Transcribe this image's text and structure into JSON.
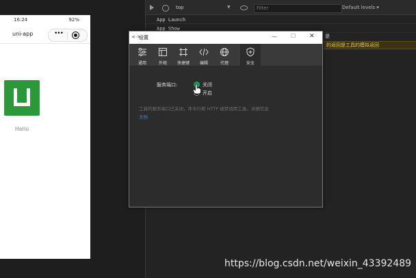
{
  "phone": {
    "time": "16:24",
    "battery": "92%",
    "nav_title": "uni-app",
    "capsule_dots": "•••",
    "hello": "Hello"
  },
  "devtools": {
    "top_select": "top",
    "filter_placeholder": "Filter",
    "levels": "Default levels ▾",
    "logs": [
      "App  Launch",
      "App  Show"
    ],
    "partial_text": "是",
    "warning_text": "的返回是工具的模拟返回"
  },
  "dialog": {
    "title": "设置",
    "icon_text": "<·>",
    "minimize": "—",
    "maximize": "☐",
    "close": "✕",
    "tabs": [
      {
        "label": "通用",
        "icon": "sliders-icon"
      },
      {
        "label": "外观",
        "icon": "window-icon"
      },
      {
        "label": "快捷键",
        "icon": "shortcut-icon"
      },
      {
        "label": "编辑",
        "icon": "code-icon"
      },
      {
        "label": "代理",
        "icon": "globe-icon"
      },
      {
        "label": "安全",
        "icon": "shield-icon"
      }
    ],
    "active_tab": "安全",
    "port_label": "服务端口:",
    "options": [
      {
        "label": "关闭",
        "selected": true
      },
      {
        "label": "开启",
        "selected": false
      }
    ],
    "description": "工具的服务端口已关闭，命令行和 HTTP 被禁调用工具。详细信息",
    "description_link": "文档"
  },
  "watermark": "https://blog.csdn.net/weixin_43392489",
  "colors": {
    "accent": "#1a9e5a",
    "logo": "#2b9939",
    "warning_bg": "#3a3213",
    "warning_text": "#e6c55a"
  }
}
